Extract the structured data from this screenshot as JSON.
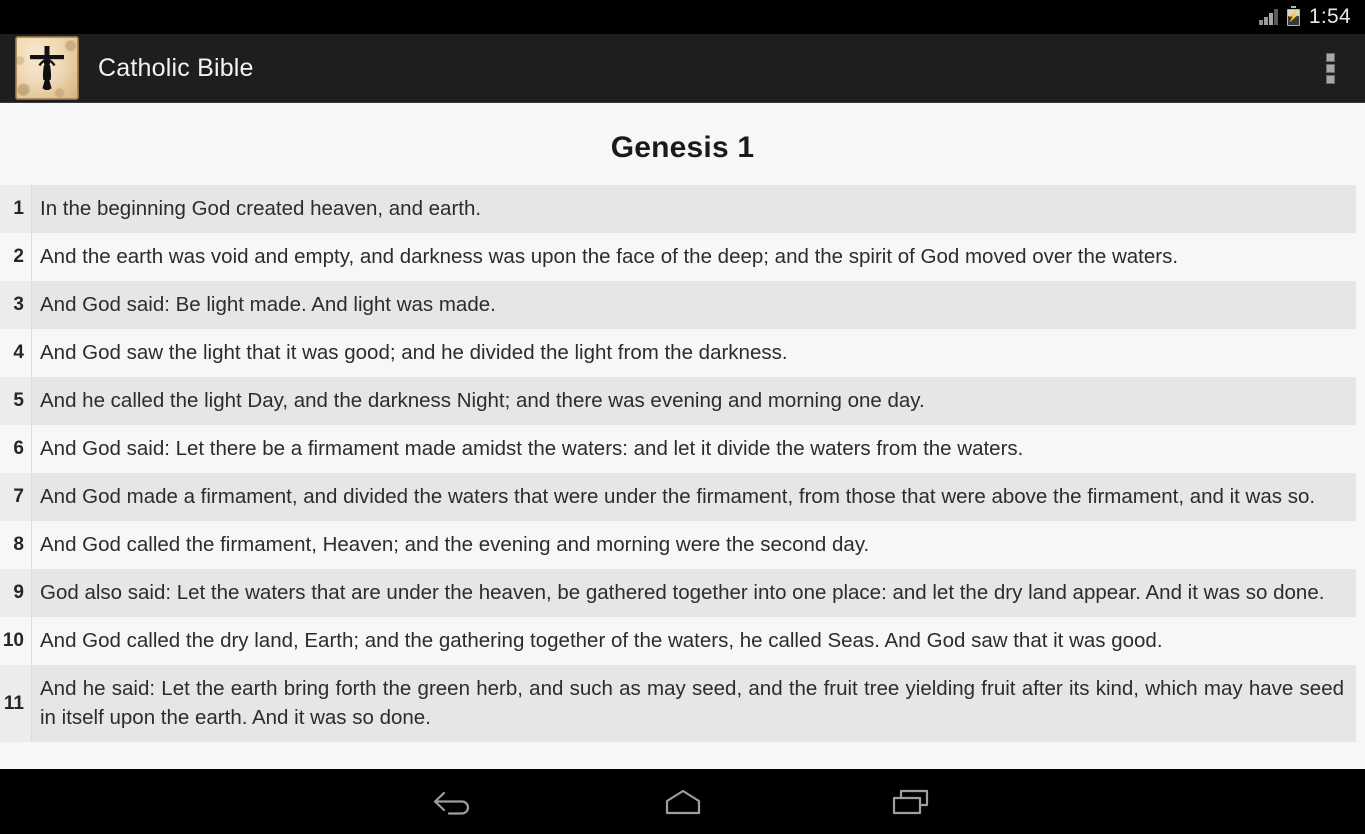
{
  "status_bar": {
    "time": "1:54",
    "signal_icon": "signal-bars-icon",
    "battery_icon": "battery-charging-icon"
  },
  "action_bar": {
    "app_icon": "crucifix-parchment-app-icon",
    "title": "Catholic Bible",
    "overflow_icon": "overflow-menu-icon"
  },
  "content": {
    "chapter_title": "Genesis 1",
    "verses": [
      {
        "num": "1",
        "text": "In the beginning God created heaven, and earth."
      },
      {
        "num": "2",
        "text": "And the earth was void and empty, and darkness was upon the face of the deep; and the spirit of God moved over the waters."
      },
      {
        "num": "3",
        "text": "And God said: Be light made. And light was made."
      },
      {
        "num": "4",
        "text": "And God saw the light that it was good; and he divided the light from the darkness."
      },
      {
        "num": "5",
        "text": "And he called the light Day, and the darkness Night; and there was evening and morning one day."
      },
      {
        "num": "6",
        "text": "And God said: Let there be a firmament made amidst the waters: and let it divide the waters from the waters."
      },
      {
        "num": "7",
        "text": "And God made a firmament, and divided the waters that were under the firmament, from those that were above the firmament, and it was so."
      },
      {
        "num": "8",
        "text": "And God called the firmament, Heaven; and the evening and morning were the second day."
      },
      {
        "num": "9",
        "text": "God also said: Let the waters that are under the heaven, be gathered together into one place: and let the dry land appear. And it was so done."
      },
      {
        "num": "10",
        "text": "And God called the dry land, Earth; and the gathering together of the waters, he called Seas. And God saw that it was good."
      },
      {
        "num": "11",
        "text": "And he said: Let the earth bring forth the green herb, and such as may seed, and the fruit tree yielding fruit after its kind, which may have seed in itself upon the earth. And it was so done."
      }
    ]
  },
  "nav_bar": {
    "back_icon": "back-arrow-icon",
    "home_icon": "home-icon",
    "recents_icon": "recent-apps-icon"
  },
  "colors": {
    "status_bar_bg": "#000000",
    "action_bar_bg": "#1e1e1e",
    "content_bg": "#f7f7f7",
    "row_shaded_bg": "#e6e6e6",
    "text": "#2c2c2c",
    "title": "#1a1a1a"
  }
}
